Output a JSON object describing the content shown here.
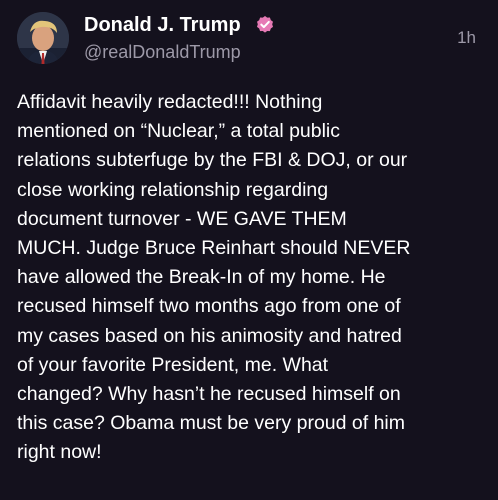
{
  "author": {
    "display_name": "Donald J. Trump",
    "handle": "@realDonaldTrump",
    "verified": true,
    "verified_icon": "verified-badge-icon",
    "avatar_icon": "profile-avatar"
  },
  "post": {
    "timestamp": "1h",
    "text": "Affidavit heavily redacted!!! Nothing\nmentioned on “Nuclear,” a total public\nrelations subterfuge by the FBI & DOJ, or our\nclose working relationship regarding\ndocument turnover - WE GAVE THEM\nMUCH. Judge Bruce Reinhart should NEVER\nhave allowed the Break-In of my home. He\nrecused himself two months ago from one of\nmy cases based on his animosity and hatred\nof your favorite President, me. What\nchanged? Why hasn’t he recused himself on\nthis case? Obama must be very proud of him\nright now!"
  },
  "colors": {
    "background": "#14111d",
    "primary_text": "#ffffff",
    "secondary_text": "#9d99a8",
    "verified_badge": "#e67ab5"
  }
}
